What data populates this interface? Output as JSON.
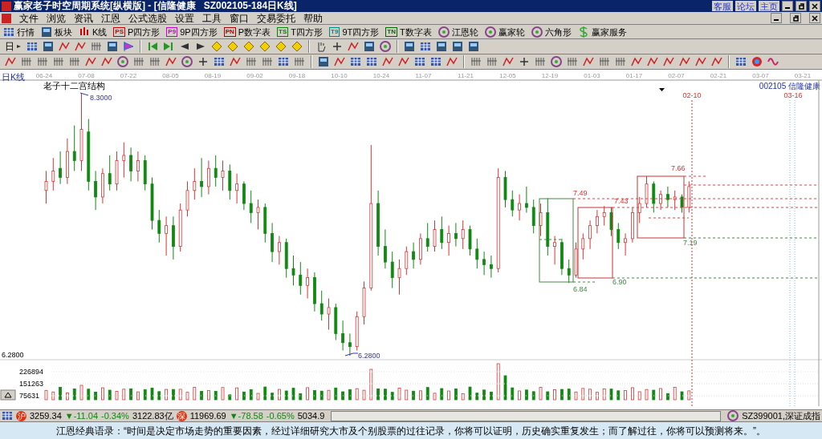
{
  "window": {
    "title": "赢家老子时空周期系统[纵横版] - [信隆健康   SZ002105-184日K线]",
    "links": [
      "客服",
      "论坛",
      "主页"
    ]
  },
  "menu": [
    "文件",
    "浏览",
    "资讯",
    "江恩",
    "公式选股",
    "设置",
    "工具",
    "窗口",
    "交易委托",
    "帮助"
  ],
  "toolbar": [
    {
      "label": "行情",
      "kind": "icon"
    },
    {
      "label": "板块",
      "kind": "icon"
    },
    {
      "label": "K线",
      "kind": "icon"
    },
    {
      "label": "P四方形",
      "kind": "badge",
      "badge": "PS",
      "color": "#cc0000"
    },
    {
      "label": "9P四方形",
      "kind": "badge",
      "badge": "P9",
      "color": "#cc00cc"
    },
    {
      "label": "P数字表",
      "kind": "badge",
      "badge": "PN",
      "color": "#aa0000"
    },
    {
      "label": "T四方形",
      "kind": "badge",
      "badge": "TS",
      "color": "#008800"
    },
    {
      "label": "9T四方形",
      "kind": "badge",
      "badge": "T9",
      "color": "#008888"
    },
    {
      "label": "T数字表",
      "kind": "badge",
      "badge": "TN",
      "color": "#006600"
    },
    {
      "label": "江恩轮",
      "kind": "icon"
    },
    {
      "label": "赢家轮",
      "kind": "icon"
    },
    {
      "label": "六角形",
      "kind": "icon"
    },
    {
      "label": "赢家服务",
      "kind": "icon"
    }
  ],
  "period_selector": "日",
  "chart": {
    "type_label": "日K线",
    "title": "老子十二宫结构",
    "stock": "002105 信隆健康",
    "date_ticks": [
      "06-24",
      "07-08",
      "07-22",
      "08-05",
      "08-19",
      "09-02",
      "09-18",
      "10-10",
      "10-24",
      "11-07",
      "11-21",
      "12-05",
      "12-19",
      "01-03",
      "01-17",
      "02-07",
      "02-21",
      "03-07",
      "03-21"
    ],
    "markers": [
      "02-10",
      "03-16"
    ],
    "high_label": "8.3000",
    "low_label": "6.2800",
    "axis_price": "6.2800",
    "box_labels": [
      "7.49",
      "7.43",
      "7.66",
      "7.19",
      "6.90",
      "6.84"
    ],
    "volume_ticks": [
      "226894",
      "151263",
      "75631"
    ],
    "chart_data": {
      "type": "candlestick",
      "ohlc": [
        [
          7.55,
          7.7,
          7.45,
          7.62
        ],
        [
          7.62,
          7.8,
          7.55,
          7.7
        ],
        [
          7.72,
          7.85,
          7.6,
          7.65
        ],
        [
          7.65,
          7.95,
          7.6,
          7.85
        ],
        [
          7.85,
          8.05,
          7.7,
          7.78
        ],
        [
          7.78,
          8.3,
          7.7,
          8.02
        ],
        [
          8.0,
          8.1,
          7.55,
          7.62
        ],
        [
          7.62,
          7.7,
          7.4,
          7.5
        ],
        [
          7.5,
          7.72,
          7.45,
          7.68
        ],
        [
          7.68,
          7.82,
          7.55,
          7.6
        ],
        [
          7.6,
          7.85,
          7.55,
          7.78
        ],
        [
          7.78,
          7.92,
          7.65,
          7.82
        ],
        [
          7.82,
          7.88,
          7.62,
          7.7
        ],
        [
          7.7,
          7.85,
          7.62,
          7.78
        ],
        [
          7.78,
          7.82,
          7.55,
          7.6
        ],
        [
          7.6,
          7.65,
          7.25,
          7.32
        ],
        [
          7.32,
          7.4,
          7.15,
          7.22
        ],
        [
          7.22,
          7.35,
          7.05,
          7.28
        ],
        [
          7.28,
          7.35,
          7.02,
          7.12
        ],
        [
          7.12,
          7.45,
          7.08,
          7.4
        ],
        [
          7.4,
          7.62,
          7.35,
          7.55
        ],
        [
          7.55,
          7.72,
          7.48,
          7.62
        ],
        [
          7.62,
          7.8,
          7.5,
          7.58
        ],
        [
          7.58,
          7.78,
          7.52,
          7.72
        ],
        [
          7.72,
          7.82,
          7.58,
          7.65
        ],
        [
          7.65,
          7.78,
          7.55,
          7.7
        ],
        [
          7.7,
          7.75,
          7.48,
          7.55
        ],
        [
          7.55,
          7.68,
          7.45,
          7.6
        ],
        [
          7.6,
          7.62,
          7.4,
          7.45
        ],
        [
          7.45,
          7.55,
          7.3,
          7.38
        ],
        [
          7.38,
          7.48,
          7.25,
          7.42
        ],
        [
          7.42,
          7.45,
          7.15,
          7.22
        ],
        [
          7.22,
          7.3,
          7.0,
          7.08
        ],
        [
          7.08,
          7.2,
          6.98,
          7.15
        ],
        [
          7.15,
          7.18,
          6.88,
          6.95
        ],
        [
          6.95,
          7.05,
          6.82,
          6.9
        ],
        [
          6.9,
          7.0,
          6.75,
          6.82
        ],
        [
          6.82,
          6.95,
          6.72,
          6.88
        ],
        [
          6.88,
          6.92,
          6.62,
          6.68
        ],
        [
          6.68,
          6.78,
          6.55,
          6.6
        ],
        [
          6.6,
          6.72,
          6.48,
          6.65
        ],
        [
          6.65,
          6.68,
          6.4,
          6.45
        ],
        [
          6.45,
          6.55,
          6.32,
          6.38
        ],
        [
          6.38,
          6.45,
          6.28,
          6.35
        ],
        [
          6.35,
          6.62,
          6.32,
          6.58
        ],
        [
          6.58,
          6.85,
          6.52,
          6.8
        ],
        [
          6.8,
          7.9,
          6.78,
          7.45
        ],
        [
          7.45,
          7.55,
          7.05,
          7.12
        ],
        [
          7.12,
          7.25,
          6.95,
          7.0
        ],
        [
          7.0,
          7.08,
          6.8,
          6.88
        ],
        [
          6.88,
          7.02,
          6.75,
          6.95
        ],
        [
          6.95,
          7.12,
          6.9,
          7.08
        ],
        [
          7.08,
          7.15,
          6.95,
          7.02
        ],
        [
          7.02,
          7.22,
          6.98,
          7.18
        ],
        [
          7.18,
          7.3,
          7.08,
          7.12
        ],
        [
          7.12,
          7.32,
          7.08,
          7.25
        ],
        [
          7.25,
          7.35,
          7.1,
          7.15
        ],
        [
          7.15,
          7.28,
          7.05,
          7.22
        ],
        [
          7.22,
          7.3,
          7.12,
          7.18
        ],
        [
          7.18,
          7.32,
          7.1,
          7.25
        ],
        [
          7.25,
          7.28,
          7.05,
          7.1
        ],
        [
          7.1,
          7.18,
          6.95,
          7.02
        ],
        [
          7.02,
          7.08,
          6.9,
          6.98
        ],
        [
          6.98,
          7.05,
          6.88,
          6.95
        ],
        [
          6.95,
          7.72,
          6.92,
          7.65
        ],
        [
          7.65,
          7.7,
          7.42,
          7.48
        ],
        [
          7.48,
          7.55,
          7.35,
          7.4
        ],
        [
          7.4,
          7.52,
          7.32,
          7.45
        ],
        [
          7.45,
          7.58,
          7.38,
          7.42
        ],
        [
          7.42,
          7.48,
          7.22,
          7.28
        ],
        [
          7.28,
          7.45,
          7.2,
          7.38
        ],
        [
          7.38,
          7.49,
          7.05,
          7.12
        ],
        [
          7.12,
          7.2,
          6.98,
          7.15
        ],
        [
          7.15,
          7.18,
          6.9,
          6.95
        ],
        [
          6.95,
          7.02,
          6.84,
          6.9
        ],
        [
          6.9,
          7.15,
          6.88,
          7.1
        ],
        [
          7.1,
          7.22,
          7.02,
          7.18
        ],
        [
          7.18,
          7.32,
          7.1,
          7.28
        ],
        [
          7.28,
          7.4,
          7.22,
          7.35
        ],
        [
          7.35,
          7.43,
          7.28,
          7.38
        ],
        [
          7.38,
          7.42,
          7.2,
          7.25
        ],
        [
          7.25,
          7.3,
          7.1,
          7.15
        ],
        [
          7.15,
          7.22,
          7.05,
          7.18
        ],
        [
          7.18,
          7.42,
          7.15,
          7.38
        ],
        [
          7.38,
          7.5,
          7.3,
          7.45
        ],
        [
          7.45,
          7.66,
          7.42,
          7.6
        ],
        [
          7.6,
          7.62,
          7.38,
          7.45
        ],
        [
          7.45,
          7.55,
          7.4,
          7.52
        ],
        [
          7.52,
          7.58,
          7.42,
          7.48
        ],
        [
          7.48,
          7.55,
          7.4,
          7.5
        ],
        [
          7.5,
          7.52,
          7.38,
          7.42
        ],
        [
          7.42,
          7.62,
          7.38,
          7.58
        ]
      ]
    }
  },
  "status": {
    "indices": [
      {
        "badge": "沪",
        "values": [
          "3259.34",
          "▼-11.04",
          "-0.34%",
          "3122.83亿"
        ]
      },
      {
        "badge": "深",
        "values": [
          "11969.69",
          "▼-78.58",
          "-0.65%",
          "5034.9"
        ]
      }
    ],
    "index_name": "SZ399001,深证成指"
  },
  "quote": "江恩经典语录：“时间是决定市场走势的重要因素，经过详细研究大市及个别股票的过往记录，你将可以证明，历史确实重复发生；而了解过往，你将可以预测将来。”。"
}
